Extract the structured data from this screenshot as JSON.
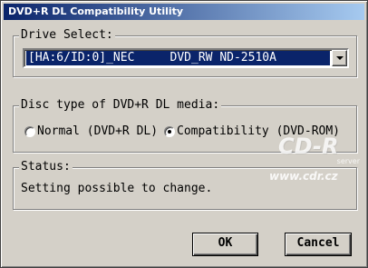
{
  "window": {
    "title": "DVD+R DL Compatibility Utility"
  },
  "drive_select": {
    "label": "Drive Select:",
    "selected_value": "[HA:6/ID:0]_NEC     DVD_RW ND-2510A"
  },
  "disc_type": {
    "label": "Disc type of DVD+R DL media:",
    "options": [
      {
        "label": "Normal (DVD+R DL)",
        "checked": false
      },
      {
        "label": "Compatibility (DVD-ROM)",
        "checked": true
      }
    ]
  },
  "status": {
    "label": "Status:",
    "text": "Setting possible to change."
  },
  "buttons": {
    "ok": "OK",
    "cancel": "Cancel"
  },
  "watermark": {
    "logo": "CD-R",
    "sub": "server",
    "url": "www.cdr.cz"
  },
  "colors": {
    "titlebar_start": "#0a246a",
    "titlebar_end": "#a6caf0",
    "face": "#d4d0c8",
    "selection": "#0a246a"
  }
}
